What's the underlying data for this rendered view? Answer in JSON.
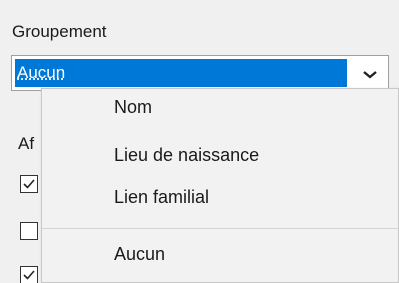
{
  "grouping": {
    "label": "Groupement",
    "selected_value": "Aucun"
  },
  "display_section": {
    "label": "Af",
    "checkboxes": [
      {
        "checked": true
      },
      {
        "checked": false
      },
      {
        "checked": true
      }
    ]
  },
  "dropdown": {
    "options": [
      {
        "label": "Nom"
      },
      {
        "label": "Lieu de naissance"
      },
      {
        "label": "Lien familial"
      },
      {
        "label": "Aucun"
      }
    ]
  },
  "colors": {
    "selection": "#0078d7",
    "background": "#f0f0f0"
  }
}
